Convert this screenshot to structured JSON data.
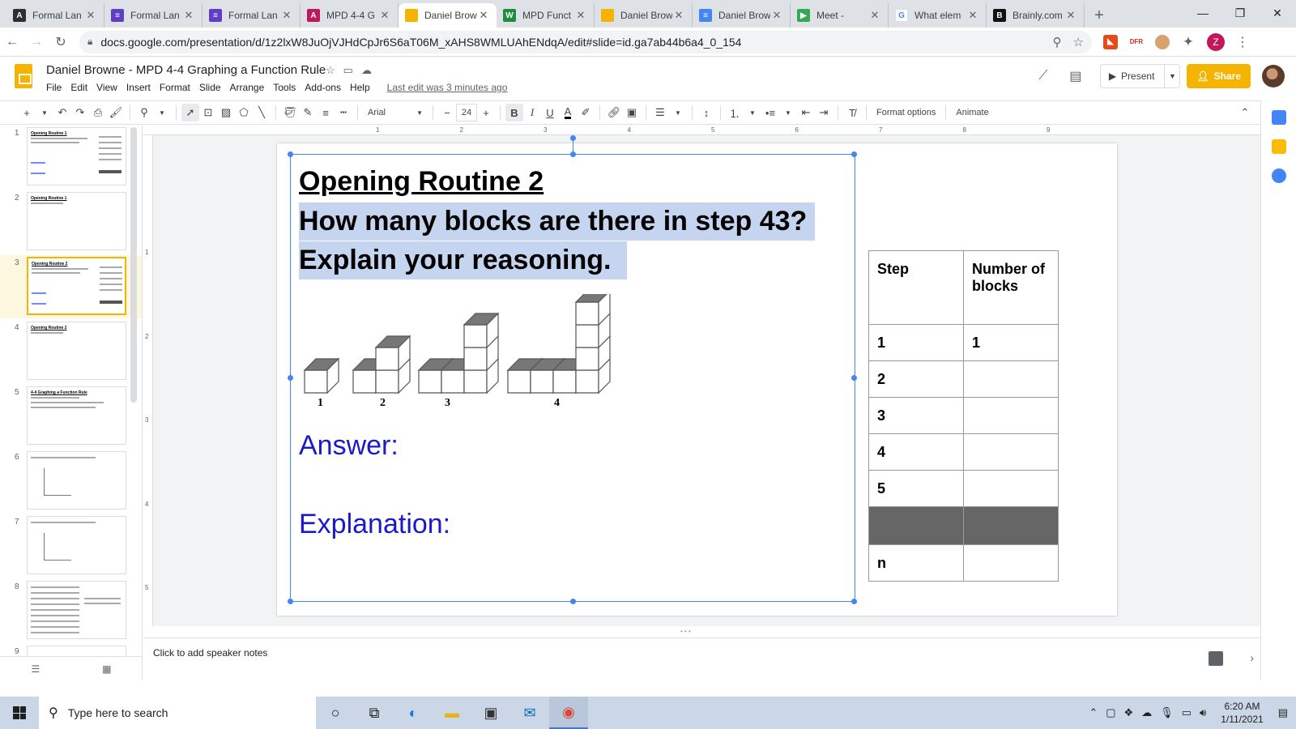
{
  "browser": {
    "tabs": [
      {
        "title": "Formal Lan",
        "color": "#2f2f2f",
        "glyph": "A"
      },
      {
        "title": "Formal Lan",
        "color": "#5f3dc4",
        "glyph": "≡"
      },
      {
        "title": "Formal Lan",
        "color": "#5f3dc4",
        "glyph": "≡"
      },
      {
        "title": "MPD 4-4 G",
        "color": "#c2185b",
        "glyph": "A"
      },
      {
        "title": "Daniel Brow",
        "color": "#f4b400",
        "glyph": ""
      },
      {
        "title": "MPD Funct",
        "color": "#1e8e3e",
        "glyph": "W"
      },
      {
        "title": "Daniel Brow",
        "color": "#f4b400",
        "glyph": ""
      },
      {
        "title": "Daniel Brow",
        "color": "#4285f4",
        "glyph": "≡"
      },
      {
        "title": "Meet - ",
        "color": "#34a853",
        "glyph": "▶"
      },
      {
        "title": "What elem",
        "color": "#ffffff",
        "glyph": "G"
      },
      {
        "title": "Brainly.com",
        "color": "#111111",
        "glyph": "B"
      }
    ],
    "url": "docs.google.com/presentation/d/1z2lxW8JuOjVJHdCpJr6S6aT06M_xAHS8WMLUAhENdqA/edit#slide=id.ga7ab44b6a4_0_154",
    "profile_initial": "Z"
  },
  "app": {
    "title": "Daniel Browne - MPD 4-4 Graphing a Function Rule",
    "menus": [
      "File",
      "Edit",
      "View",
      "Insert",
      "Format",
      "Slide",
      "Arrange",
      "Tools",
      "Add-ons",
      "Help"
    ],
    "last_edit": "Last edit was 3 minutes ago",
    "present_label": "Present",
    "share_label": "Share",
    "accent_color": "#f4b400"
  },
  "toolbar": {
    "font": "Arial",
    "font_size": "24",
    "format_options": "Format options",
    "animate": "Animate"
  },
  "rulers": {
    "h": [
      "1",
      "2",
      "3",
      "4",
      "5",
      "6",
      "7",
      "8",
      "9"
    ],
    "v": [
      "1",
      "2",
      "3",
      "4",
      "5"
    ]
  },
  "filmstrip": [
    {
      "num": "1",
      "title": "Opening Routine 1"
    },
    {
      "num": "2",
      "title": "Opening Routine 1"
    },
    {
      "num": "3",
      "title": "Opening Routine 2"
    },
    {
      "num": "4",
      "title": "Opening Routine 2"
    },
    {
      "num": "5",
      "title": "4-4 Graphing a Function Rule"
    },
    {
      "num": "6",
      "title": ""
    },
    {
      "num": "7",
      "title": ""
    },
    {
      "num": "8",
      "title": ""
    },
    {
      "num": "9",
      "title": ""
    }
  ],
  "slide": {
    "heading": "Opening Routine 2",
    "question_line1": "How many blocks are there in step 43?",
    "question_line2": "Explain your reasoning.",
    "answer_label": "Answer:",
    "explanation_label": "Explanation:",
    "figure_labels": [
      "1",
      "2",
      "3",
      "4"
    ],
    "table": {
      "headers": [
        "Step",
        "Number of blocks"
      ],
      "rows": [
        [
          "1",
          "1"
        ],
        [
          "2",
          ""
        ],
        [
          "3",
          ""
        ],
        [
          "4",
          ""
        ],
        [
          "5",
          ""
        ],
        [
          "",
          ""
        ],
        [
          "n",
          ""
        ]
      ]
    }
  },
  "notes": {
    "placeholder": "Click to add speaker notes"
  },
  "taskbar": {
    "search_placeholder": "Type here to search",
    "time": "6:20 AM",
    "date": "1/11/2021"
  }
}
